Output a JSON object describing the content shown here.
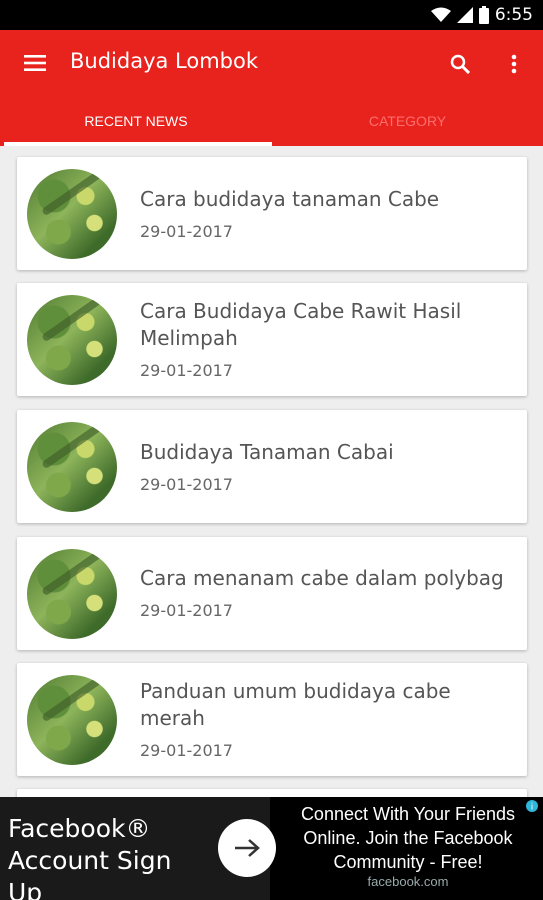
{
  "status_bar": {
    "time": "6:55",
    "icons": [
      "wifi-icon",
      "signal-icon",
      "battery-icon"
    ]
  },
  "appbar": {
    "title": "Budidaya Lombok",
    "color": "#e8221c",
    "icons": [
      "menu-icon",
      "search-icon",
      "more-vert-icon"
    ]
  },
  "tabs": [
    {
      "label": "RECENT NEWS",
      "active": true
    },
    {
      "label": "CATEGORY",
      "active": false
    }
  ],
  "articles": [
    {
      "title": "Cara budidaya tanaman Cabe",
      "date": "29-01-2017"
    },
    {
      "title": "Cara Budidaya Cabe Rawit Hasil Melimpah",
      "date": "29-01-2017"
    },
    {
      "title": "Budidaya Tanaman Cabai",
      "date": "29-01-2017"
    },
    {
      "title": "Cara menanam cabe dalam polybag",
      "date": "29-01-2017"
    },
    {
      "title": "Panduan umum budidaya cabe merah",
      "date": "29-01-2017"
    }
  ],
  "ad": {
    "left_text": "Facebook® Account Sign Up",
    "right_text": "Connect With Your Friends Online. Join the Facebook Community - Free!",
    "domain": "facebook.com",
    "icons": [
      "arrow-right-icon",
      "ad-choices-icon"
    ]
  }
}
